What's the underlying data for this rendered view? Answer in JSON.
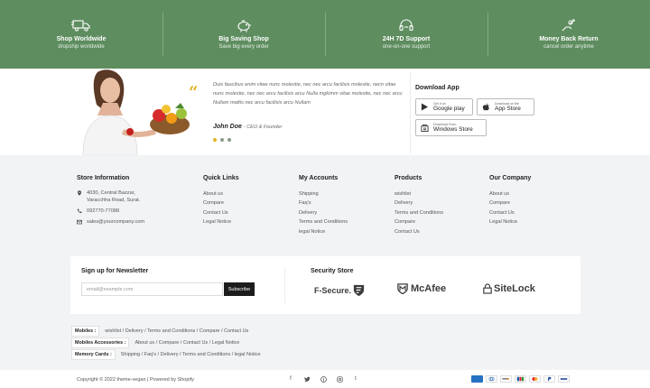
{
  "features": [
    {
      "icon": "truck-icon",
      "title": "Shop Worldwide",
      "subtitle": "dropship worldwide"
    },
    {
      "icon": "piggy-bank-icon",
      "title": "Big Saving Shop",
      "subtitle": "Save big every order"
    },
    {
      "icon": "headset-icon",
      "title": "24H 7D Support",
      "subtitle": "one-on-one support"
    },
    {
      "icon": "money-hand-icon",
      "title": "Money Back Return",
      "subtitle": "cancel order anytime"
    }
  ],
  "testimonial": {
    "quote": "Duis faucibus enim vitae nunc molestie, nec nec arcu facilisis molestie, necn vitae nunc molestie, nec nec arcu facilisis arcu Nulla mgkimm vitae molestie, nec nec arcu Nullam mattis nec arcu facilisis arcu Nullam",
    "author": "John Doe",
    "role": "- CEO & Founder"
  },
  "download": {
    "title": "Download App",
    "google": {
      "small": "Get it on",
      "large": "Google play"
    },
    "apple": {
      "small": "Download on the",
      "large": "App Store"
    },
    "windows": {
      "small": "Download From",
      "large": "Windows Store"
    }
  },
  "store_info": {
    "title": "Store Information",
    "address_line1": "4030, Central Bazzar,",
    "address_line2": "Varacchha Road, Surat.",
    "phone": "092770-77088",
    "email": "sales@yourcompany.com"
  },
  "quick_links": {
    "title": "Quick Links",
    "items": [
      "About us",
      "Compare",
      "Contact Us",
      "Legal Notice"
    ]
  },
  "my_accounts": {
    "title": "My Accounts",
    "items": [
      "Shipping",
      "Faq's",
      "Delivery",
      "Terms and Conditions",
      "legal Notice"
    ]
  },
  "products": {
    "title": "Products",
    "items": [
      "wishlist",
      "Delivery",
      "Terms and Conditions",
      "Compare",
      "Contact Us"
    ]
  },
  "our_company": {
    "title": "Our Company",
    "items": [
      "About us",
      "Compare",
      "Contact Us",
      "Legal Notice"
    ]
  },
  "newsletter": {
    "title": "Sign up for Newsletter",
    "placeholder": "email@example.com",
    "button": "Subscribe"
  },
  "security": {
    "title": "Security Store",
    "logos": [
      "F-Secure.",
      "McAfee",
      "SiteLock"
    ]
  },
  "tags": [
    {
      "label": "Mobiles :",
      "links": [
        "wishlist",
        "Delivery",
        "Terms and Conditions",
        "Compare",
        "Contact Us"
      ]
    },
    {
      "label": "Mobiles Accessories :",
      "links": [
        "About us",
        "Compare",
        "Contact Us",
        "Legal Notice"
      ]
    },
    {
      "label": "Memory Cards :",
      "links": [
        "Shipping",
        "Faq's",
        "Delivery",
        "Terms and Conditions",
        "legal Notice"
      ]
    }
  ],
  "copyright": "Copyright © 2022 theme-vegan | Powered by Shopify",
  "socials": [
    "facebook-icon",
    "twitter-icon",
    "pinterest-icon",
    "instagram-icon",
    "tumblr-icon"
  ],
  "payments": [
    "amex-icon",
    "diners-icon",
    "discover-icon",
    "jcb-icon",
    "mastercard-icon",
    "paypal-icon",
    "visa-icon"
  ],
  "colors": {
    "brand_green": "#5e8d5f",
    "accent_yellow": "#e2b326",
    "dark": "#1c1c1c"
  }
}
